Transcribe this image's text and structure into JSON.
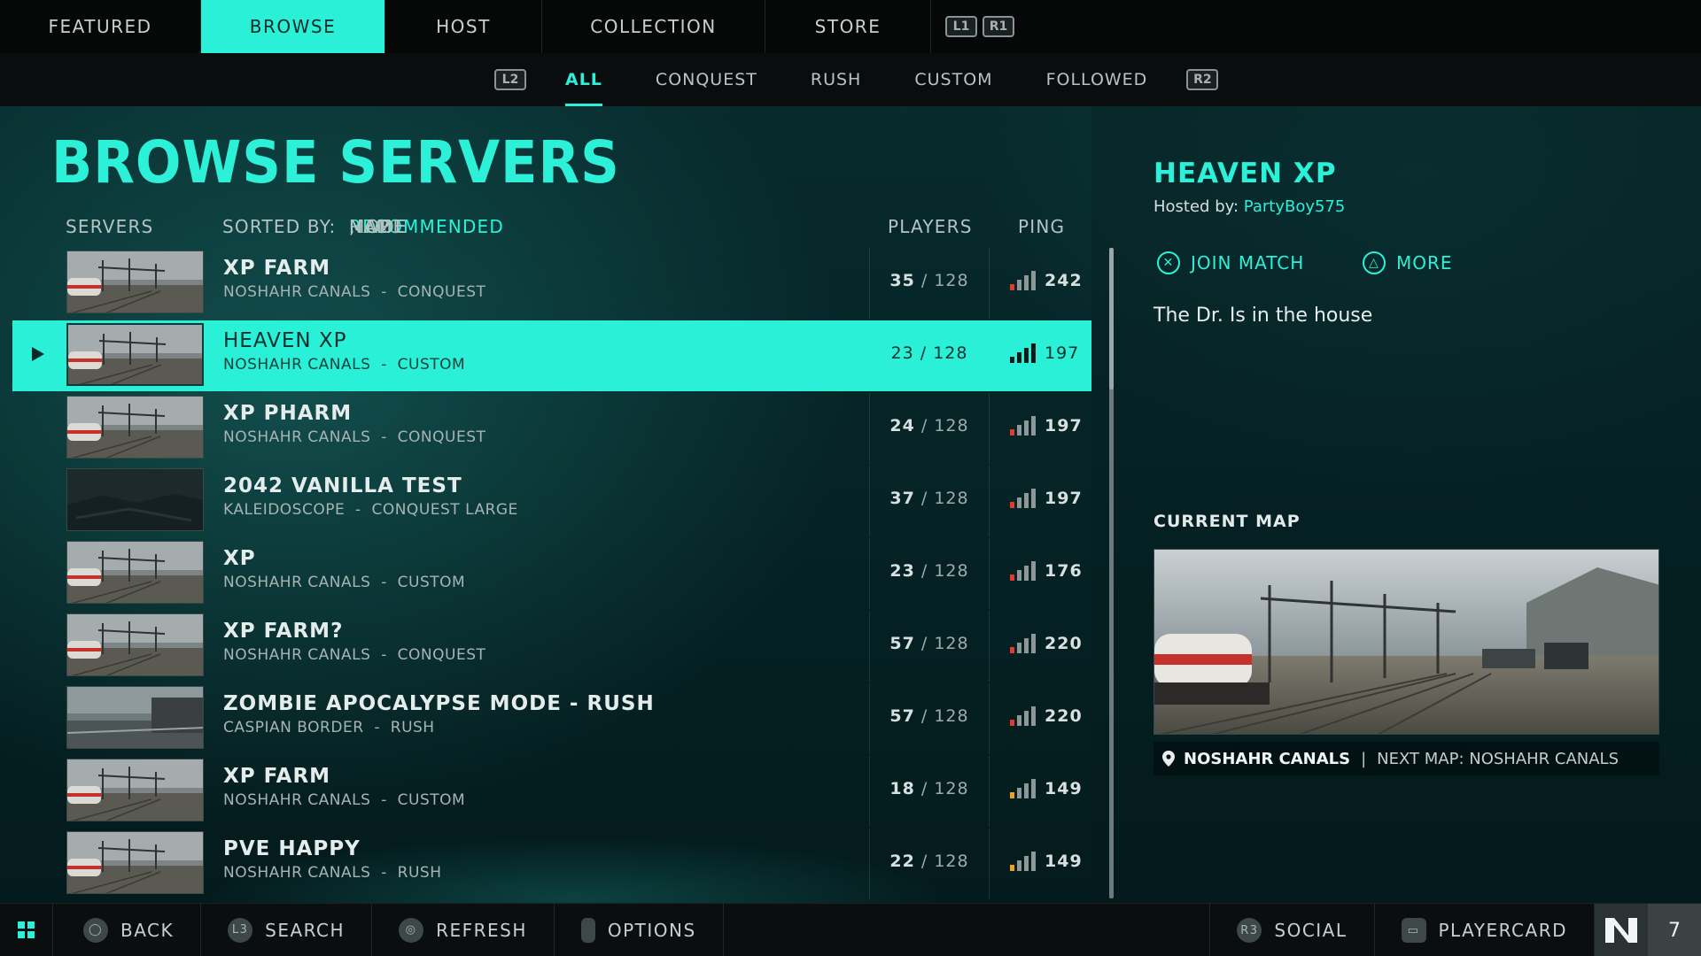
{
  "top_nav": {
    "tabs": [
      {
        "label": "FEATURED",
        "active": false
      },
      {
        "label": "BROWSE",
        "active": true
      },
      {
        "label": "HOST",
        "active": false
      },
      {
        "label": "COLLECTION",
        "active": false
      },
      {
        "label": "STORE",
        "active": false
      }
    ],
    "shoulder_left": "L1",
    "shoulder_right": "R1"
  },
  "sub_nav": {
    "trigger_left": "L2",
    "trigger_right": "R2",
    "tabs": [
      {
        "label": "ALL",
        "active": true
      },
      {
        "label": "CONQUEST",
        "active": false
      },
      {
        "label": "RUSH",
        "active": false
      },
      {
        "label": "CUSTOM",
        "active": false
      },
      {
        "label": "FOLLOWED",
        "active": false
      }
    ]
  },
  "page_title": "BROWSE SERVERS",
  "list_header": {
    "servers": "SERVERS",
    "sorted_by": "SORTED BY:",
    "sort_options": [
      "RECOMMENDED",
      "NAME",
      "MODE",
      "MAP"
    ],
    "active_sort": "RECOMMENDED",
    "players": "PLAYERS",
    "ping": "PING"
  },
  "servers": [
    {
      "name": "XP FARM",
      "map": "NOSHAHR CANALS",
      "mode": "CONQUEST",
      "players": "35",
      "max": "128",
      "ping": "242",
      "signal": "poor",
      "thumb": "rail",
      "selected": false
    },
    {
      "name": "HEAVEN XP",
      "map": "NOSHAHR CANALS",
      "mode": "CUSTOM",
      "players": "23",
      "max": "128",
      "ping": "197",
      "signal": "good",
      "thumb": "rail",
      "selected": true
    },
    {
      "name": "XP PHARM",
      "map": "NOSHAHR CANALS",
      "mode": "CONQUEST",
      "players": "24",
      "max": "128",
      "ping": "197",
      "signal": "poor",
      "thumb": "rail",
      "selected": false
    },
    {
      "name": "2042 VANILLA TEST",
      "map": "KALEIDOSCOPE",
      "mode": "CONQUEST LARGE",
      "players": "37",
      "max": "128",
      "ping": "197",
      "signal": "poor",
      "thumb": "dark",
      "selected": false
    },
    {
      "name": "XP",
      "map": "NOSHAHR CANALS",
      "mode": "CUSTOM",
      "players": "23",
      "max": "128",
      "ping": "176",
      "signal": "poor",
      "thumb": "rail",
      "selected": false
    },
    {
      "name": "XP FARM?",
      "map": "NOSHAHR CANALS",
      "mode": "CONQUEST",
      "players": "57",
      "max": "128",
      "ping": "220",
      "signal": "poor",
      "thumb": "rail",
      "selected": false
    },
    {
      "name": "ZOMBIE APOCALYPSE MODE - RUSH",
      "map": "CASPIAN BORDER",
      "mode": "RUSH",
      "players": "57",
      "max": "128",
      "ping": "220",
      "signal": "poor",
      "thumb": "highway",
      "selected": false
    },
    {
      "name": "XP FARM",
      "map": "NOSHAHR CANALS",
      "mode": "CUSTOM",
      "players": "18",
      "max": "128",
      "ping": "149",
      "signal": "fair",
      "thumb": "rail",
      "selected": false
    },
    {
      "name": "PVE HAPPY",
      "map": "NOSHAHR CANALS",
      "mode": "RUSH",
      "players": "22",
      "max": "128",
      "ping": "149",
      "signal": "fair",
      "thumb": "rail",
      "selected": false
    }
  ],
  "details": {
    "title": "HEAVEN XP",
    "hosted_by_label": "Hosted by:",
    "host": "PartyBoy575",
    "join_label": "JOIN MATCH",
    "more_label": "MORE",
    "description": "The Dr. Is in the house",
    "current_map_label": "CURRENT MAP",
    "current_map": "NOSHAHR CANALS",
    "next_map": "NEXT MAP: NOSHAHR CANALS"
  },
  "bottom_bar": {
    "back": "BACK",
    "search": "SEARCH",
    "refresh": "REFRESH",
    "options": "OPTIONS",
    "social": "SOCIAL",
    "playercard": "PLAYERCARD",
    "notifications": "7"
  },
  "colors": {
    "accent": "#29f0d6",
    "signal_poor": "#e23a2e",
    "signal_fair": "#f0a020",
    "signal_good": "#0c1a1a"
  }
}
